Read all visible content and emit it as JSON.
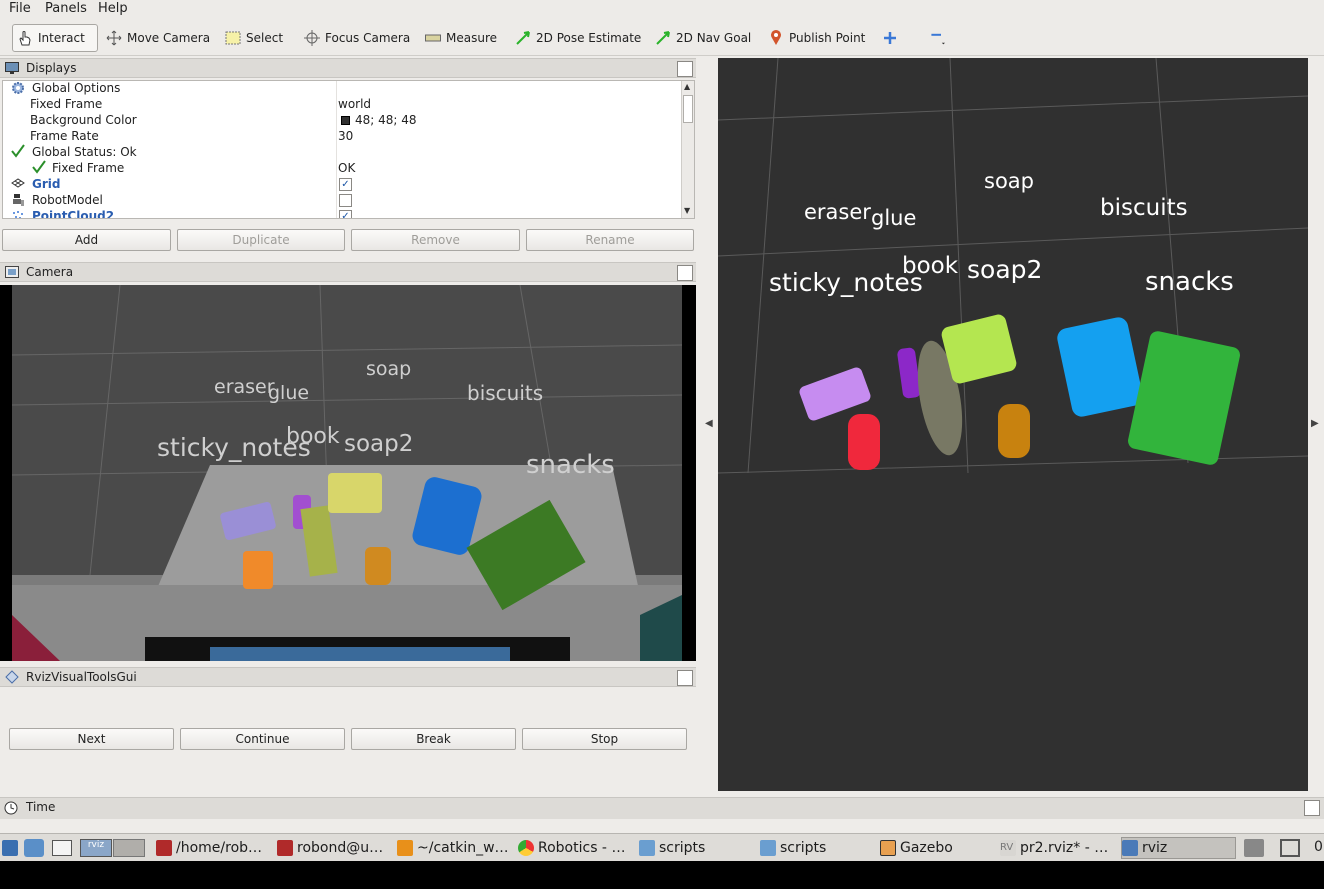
{
  "menubar": {
    "items": [
      "File",
      "Panels",
      "Help"
    ]
  },
  "toolbar": {
    "tools": [
      {
        "label": "Interact",
        "icon": "hand-pointer-icon"
      },
      {
        "label": "Move Camera",
        "icon": "move-arrows-icon"
      },
      {
        "label": "Select",
        "icon": "select-rectangle-icon"
      },
      {
        "label": "Focus Camera",
        "icon": "focus-crosshair-icon"
      },
      {
        "label": "Measure",
        "icon": "ruler-icon"
      },
      {
        "label": "2D Pose Estimate",
        "icon": "green-arrow-icon"
      },
      {
        "label": "2D Nav Goal",
        "icon": "green-arrow-icon"
      },
      {
        "label": "Publish Point",
        "icon": "map-pin-icon"
      }
    ],
    "add_tool_icon": "plus-icon",
    "remove_tool_icon": "minus-icon"
  },
  "displays": {
    "title": "Displays",
    "rows": [
      {
        "label": "Global Options",
        "value": ""
      },
      {
        "label": "Fixed Frame",
        "value": "world"
      },
      {
        "label": "Background Color",
        "value": "48; 48; 48"
      },
      {
        "label": "Frame Rate",
        "value": "30"
      },
      {
        "label": "Global Status: Ok",
        "value": ""
      },
      {
        "label": "Fixed Frame",
        "value": "OK"
      },
      {
        "label": "Grid",
        "value": ""
      },
      {
        "label": "RobotModel",
        "value": ""
      },
      {
        "label": "PointCloud2",
        "value": ""
      }
    ],
    "grid_enabled": true,
    "robotmodel_enabled": false,
    "pointcloud_enabled": true,
    "background_swatch": "#303030",
    "buttons": {
      "add": "Add",
      "duplicate": "Duplicate",
      "remove": "Remove",
      "rename": "Rename"
    }
  },
  "camera_panel": {
    "title": "Camera",
    "labels": [
      "eraser",
      "glue",
      "soap",
      "biscuits",
      "sticky_notes",
      "book",
      "soap2",
      "snacks"
    ]
  },
  "visual_tools": {
    "title": "RvizVisualToolsGui",
    "buttons": {
      "next": "Next",
      "continue": "Continue",
      "break": "Break",
      "stop": "Stop"
    }
  },
  "view3d": {
    "labels": [
      "soap",
      "eraser",
      "glue",
      "biscuits",
      "book",
      "soap2",
      "sticky_notes",
      "snacks"
    ],
    "cluster_colors": {
      "eraser": "#c68cf0",
      "sticky_notes": "#f0283c",
      "glue": "#8c28c8",
      "book": "#787864",
      "soap2": "#b4e650",
      "soap": "#c8820f",
      "biscuits": "#14a0f0",
      "snacks": "#32b43c"
    }
  },
  "time_panel": {
    "title": "Time"
  },
  "taskbar": {
    "items": [
      {
        "label": "/home/rob…",
        "icon": "terminal-red-icon"
      },
      {
        "label": "robond@u…",
        "icon": "terminal-red-icon"
      },
      {
        "label": "~/catkin_w…",
        "icon": "sublime-text-icon"
      },
      {
        "label": "Robotics - …",
        "icon": "chrome-icon"
      },
      {
        "label": "scripts",
        "icon": "folder-icon"
      },
      {
        "label": "scripts",
        "icon": "folder-icon"
      },
      {
        "label": "Gazebo",
        "icon": "gazebo-icon"
      },
      {
        "label": "pr2.rviz* - …",
        "icon": "rviz-icon"
      },
      {
        "label": "rviz",
        "icon": "window-icon"
      }
    ],
    "tray_text": "0"
  }
}
